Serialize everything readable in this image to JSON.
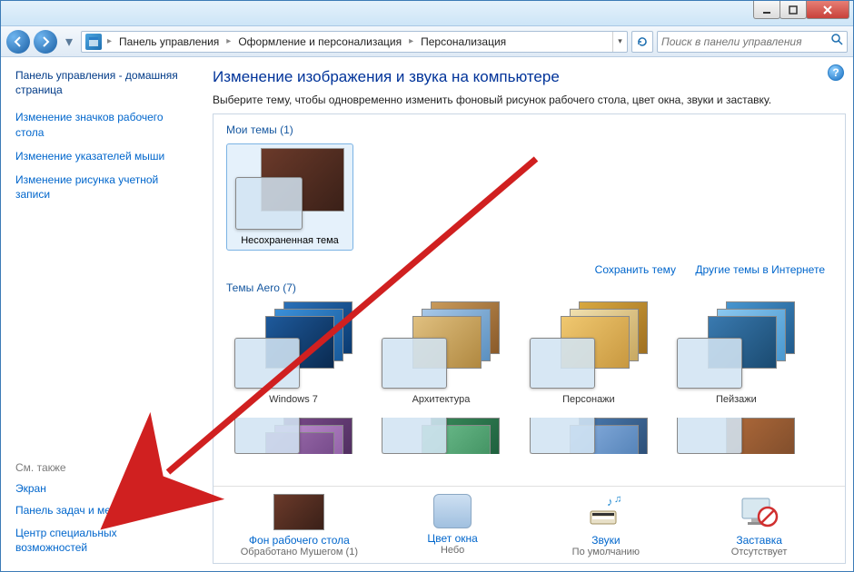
{
  "breadcrumb": {
    "seg1": "Панель управления",
    "seg2": "Оформление и персонализация",
    "seg3": "Персонализация"
  },
  "search": {
    "placeholder": "Поиск в панели управления"
  },
  "sidebar": {
    "home": "Панель управления - домашняя страница",
    "links": [
      "Изменение значков рабочего стола",
      "Изменение указателей мыши",
      "Изменение рисунка учетной записи"
    ],
    "see_also_label": "См. также",
    "see_also": [
      "Экран",
      "Панель задач и меню ''Пуск''",
      "Центр специальных возможностей"
    ]
  },
  "main": {
    "title": "Изменение изображения и звука на компьютере",
    "subtitle": "Выберите тему, чтобы одновременно изменить фоновый рисунок рабочего стола, цвет окна, звуки и заставку.",
    "my_themes_label": "Мои темы (1)",
    "my_themes": [
      {
        "name": "Несохраненная тема"
      }
    ],
    "save_theme": "Сохранить тему",
    "more_online": "Другие темы в Интернете",
    "aero_label": "Темы Aero (7)",
    "aero": [
      "Windows 7",
      "Архитектура",
      "Персонажи",
      "Пейзажи"
    ],
    "tiles": {
      "bg": {
        "label": "Фон рабочего стола",
        "sub": "Обработано Мушегом (1)"
      },
      "color": {
        "label": "Цвет окна",
        "sub": "Небо"
      },
      "sounds": {
        "label": "Звуки",
        "sub": "По умолчанию"
      },
      "saver": {
        "label": "Заставка",
        "sub": "Отсутствует"
      }
    }
  }
}
